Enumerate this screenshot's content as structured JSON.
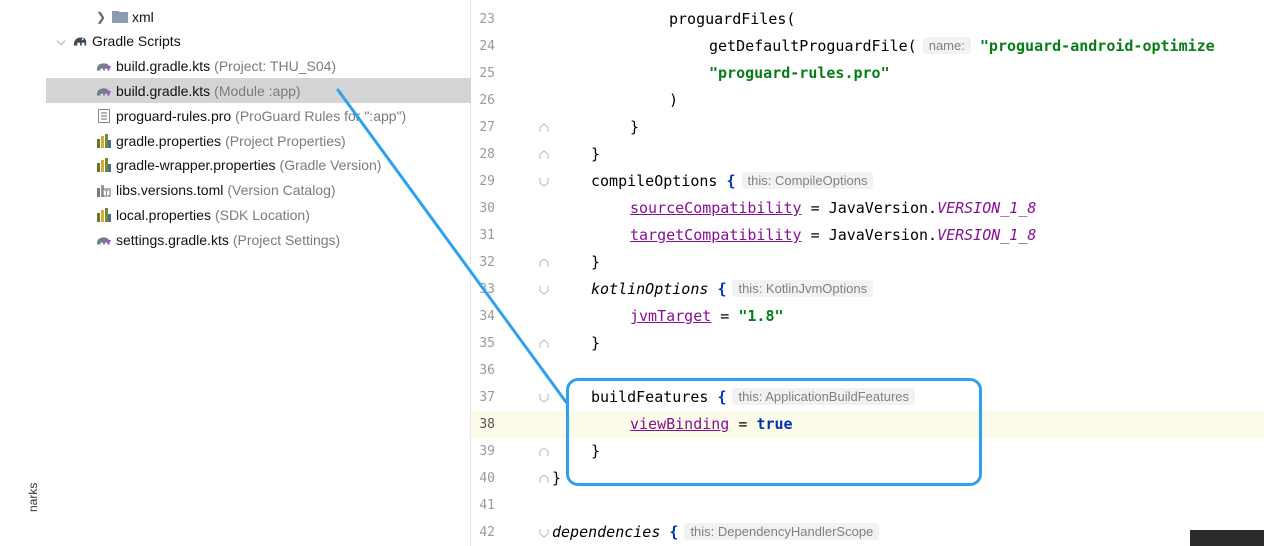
{
  "sidebar_stripe_label": "narks",
  "project_tree": [
    {
      "label": "xml",
      "hint": "",
      "arrow": ">",
      "indent": 1,
      "icon": "folder-icon",
      "selected": false
    },
    {
      "label": "Gradle Scripts",
      "hint": "",
      "arrow": "v",
      "indent": 0,
      "icon": "gradle-elephant-icon",
      "selected": false
    },
    {
      "label": "build.gradle.kts",
      "hint": "(Project: THU_S04)",
      "arrow": "",
      "indent": 2,
      "icon": "gradle-kts-icon",
      "selected": false
    },
    {
      "label": "build.gradle.kts",
      "hint": "(Module :app)",
      "arrow": "",
      "indent": 2,
      "icon": "gradle-kts-icon",
      "selected": true
    },
    {
      "label": "proguard-rules.pro",
      "hint": "(ProGuard Rules for \":app\")",
      "arrow": "",
      "indent": 2,
      "icon": "text-file-icon",
      "selected": false
    },
    {
      "label": "gradle.properties",
      "hint": "(Project Properties)",
      "arrow": "",
      "indent": 2,
      "icon": "properties-icon",
      "selected": false
    },
    {
      "label": "gradle-wrapper.properties",
      "hint": "(Gradle Version)",
      "arrow": "",
      "indent": 2,
      "icon": "properties-icon",
      "selected": false
    },
    {
      "label": "libs.versions.toml",
      "hint": "(Version Catalog)",
      "arrow": "",
      "indent": 2,
      "icon": "toml-icon",
      "selected": false
    },
    {
      "label": "local.properties",
      "hint": "(SDK Location)",
      "arrow": "",
      "indent": 2,
      "icon": "properties-icon",
      "selected": false
    },
    {
      "label": "settings.gradle.kts",
      "hint": "(Project Settings)",
      "arrow": "",
      "indent": 2,
      "icon": "gradle-kts-icon",
      "selected": false
    }
  ],
  "editor": {
    "line_numbers": [
      "23",
      "24",
      "25",
      "26",
      "27",
      "28",
      "29",
      "30",
      "31",
      "32",
      "33",
      "34",
      "35",
      "36",
      "37",
      "38",
      "39",
      "40",
      "41",
      "42"
    ],
    "current_line": "38",
    "inlays": {
      "name": "name:",
      "compile_options": "this: CompileOptions",
      "kotlin_jvm_options": "this: KotlinJvmOptions",
      "build_features": "this: ApplicationBuildFeatures",
      "dependency_handler": "this: DependencyHandlerScope"
    },
    "tokens": {
      "proguard_files": "proguardFiles(",
      "get_default_proguard": "getDefaultProguardFile(",
      "proguard_android_optimize": "\"proguard-android-optimize",
      "proguard_rules": "\"proguard-rules.pro\"",
      "close_paren": ")",
      "close_brace": "}",
      "open_brace": "{",
      "compile_options": "compileOptions",
      "source_compat": "sourceCompatibility",
      "target_compat": "targetCompatibility",
      "equals": " = ",
      "java_version": "JavaVersion.",
      "version_1_8": "VERSION_1_8",
      "kotlin_options": "kotlinOptions",
      "jvm_target": "jvmTarget",
      "jvm_target_value": "\"1.8\"",
      "build_features": "buildFeatures",
      "view_binding": "viewBinding",
      "true_kw": "true",
      "dependencies": "dependencies"
    }
  },
  "colors": {
    "highlight": "#2ea0ee",
    "keyword": "#0033b3",
    "string": "#067d17",
    "property": "#871094"
  }
}
